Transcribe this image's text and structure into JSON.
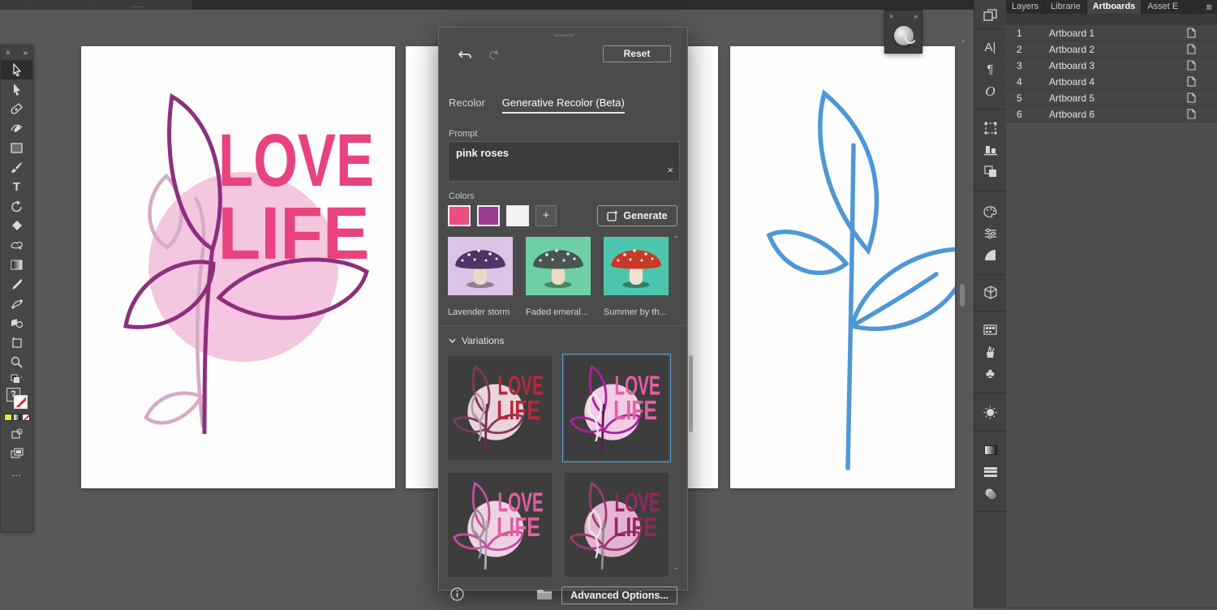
{
  "menubar": {
    "fragment_glyphs": [
      "˙",
      "˙",
      "‥‥‥"
    ]
  },
  "toolbar": {
    "close_icon": "×",
    "expand_icon": "»",
    "type_tool_glyph": "T",
    "fill_unknown_glyph": "?",
    "more_glyph": "…",
    "tools": [
      "selection",
      "direct-selection",
      "pen",
      "curvature",
      "rectangle",
      "paintbrush",
      "type",
      "rotate",
      "eraser",
      "shape-builder",
      "gradient",
      "eyedropper",
      "blend",
      "symbol-sprayer",
      "artboard",
      "zoom"
    ]
  },
  "float_panel": {
    "close_icon": "×",
    "expand_icon": "»",
    "tool": "rotate-view"
  },
  "dialog": {
    "reset_label": "Reset",
    "tab_recolor": "Recolor",
    "tab_generative": "Generative Recolor (Beta)",
    "prompt_label": "Prompt",
    "prompt_value": "pink roses",
    "clear_icon": "×",
    "colors_label": "Colors",
    "add_icon": "+",
    "generate_label": "Generate",
    "swatches": [
      {
        "hex": "#ec4d82",
        "style": "background:#ec4d82"
      },
      {
        "hex": "#9d3b95",
        "style": "background:#9d3b95"
      },
      {
        "hex": "#f4f2f3",
        "style": "background:#f4f2f3"
      }
    ],
    "presets": [
      {
        "label": "Lavender storm",
        "style": "--bg:#d9c4e6; --cap:#4f3566; --stem:#ecd9c8"
      },
      {
        "label": "Faded emeral...",
        "style": "--bg:#6fd0a4; --cap:#475651; --stem:#ecd9c8"
      },
      {
        "label": "Summer by th...",
        "style": "--bg:#4cc7ad; --cap:#c93a28; --stem:#f0e0d0"
      }
    ],
    "preset_scroll_up": "⌃",
    "variations_label": "Variations",
    "variations_chevron": "⌄",
    "variations": [
      {
        "selected": false,
        "style": "--c:#ecd4dd; --t:#b8293a; --s:#6e2a50; --l:#7d3a5f; --a:#b59aa5"
      },
      {
        "selected": true,
        "style": "--c:#f2cde4; --t:#e35f9e; --s:#5f1b52; --l:#a524a0; --a:#f0f0f0"
      },
      {
        "selected": false,
        "style": "--c:#eed2e2; --t:#df5f9f; --s:#b0a8ac; --l:#c24fa0; --a:#9a8f96"
      },
      {
        "selected": false,
        "style": "--c:#e5b3d2; --t:#93285c; --s:#8f8a8e; --l:#9c3a70; --a:#e8e3e6"
      }
    ],
    "scroll_down": "⌄",
    "advanced_options_label": "Advanced Options..."
  },
  "artwork": {
    "line1": "LOVE",
    "line2": "LIFE",
    "board1_style": "--c:#f5c6e0; --t:#e8437e; --s:#8c2f7d; --l:#8c2f7d; --a:#d9a9c9",
    "plant_stroke": "#4f97d6"
  },
  "right_panel": {
    "tabs": [
      {
        "label": "Layers"
      },
      {
        "label": "Librarie"
      },
      {
        "label": "Artboards"
      },
      {
        "label": "Asset E"
      }
    ],
    "active_tab": "Artboards",
    "menu_icon": "≡",
    "artboards": [
      {
        "num": "1",
        "name": "Artboard 1"
      },
      {
        "num": "2",
        "name": "Artboard 2"
      },
      {
        "num": "3",
        "name": "Artboard 3"
      },
      {
        "num": "4",
        "name": "Artboard 4"
      },
      {
        "num": "5",
        "name": "Artboard 5"
      },
      {
        "num": "6",
        "name": "Artboard 6"
      }
    ]
  },
  "dock": {
    "char_glyph": "A|",
    "paragraph_glyph": "¶",
    "opentype_glyph": "O",
    "symbols_glyph": "♣"
  },
  "canvas_scroll": {
    "up_chevron": "⌃"
  }
}
